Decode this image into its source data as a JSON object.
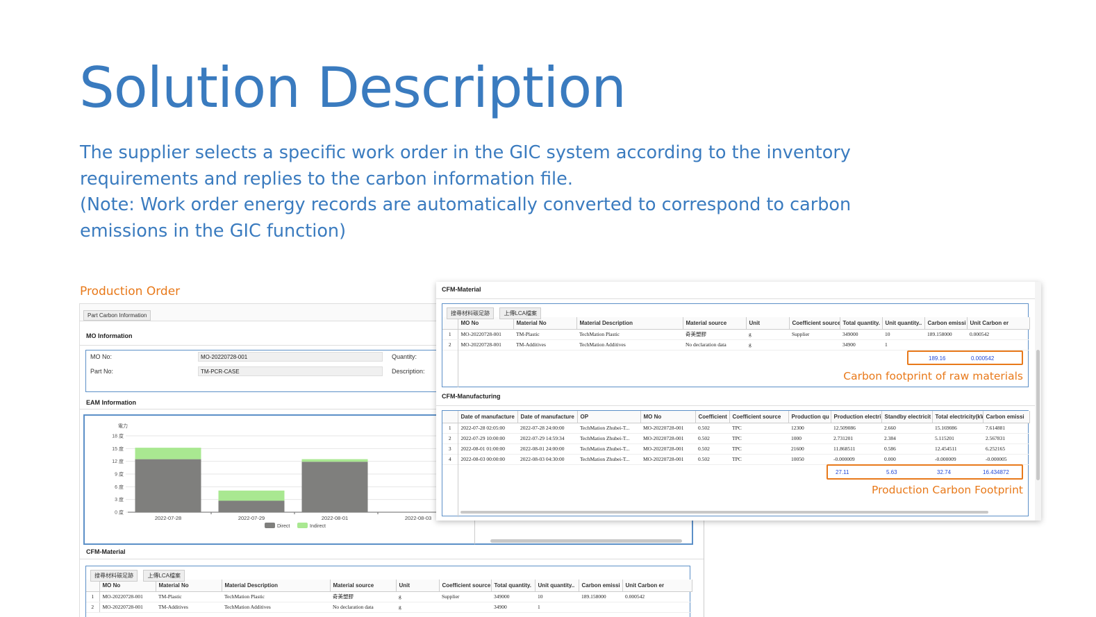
{
  "title": "Solution Description",
  "description": [
    "The supplier selects a specific work order in the GIC system according to the inventory",
    "requirements and replies to the carbon information file.",
    "(Note: Work order energy records are automatically converted to correspond to carbon",
    "emissions in the GIC function)"
  ],
  "production_order_label": "Production Order",
  "back": {
    "tab_label": "Part Carbon Information",
    "mo_section": "MO Information",
    "mo_no_label": "MO No:",
    "mo_no_value": "MO-20220728-001",
    "quantity_label": "Quantity:",
    "part_no_label": "Part No:",
    "part_no_value": "TM-PCR-CASE",
    "description_label": "Description:",
    "eam_section": "EAM Information",
    "cfm_material_section": "CFM-Material",
    "btn_search": "搜尋材料碳足跡",
    "btn_upload": "上傳LCA檔案",
    "headers": [
      "",
      "MO No",
      "Material No",
      "Material Description",
      "Material source",
      "Unit",
      "Coefficient source",
      "Total quantity.",
      "Unit quantity..",
      "Carbon emissi",
      "Unit Carbon er"
    ],
    "rows": [
      [
        "1",
        "MO-20220728-001",
        "TM-Plastic",
        "TechMation Plastic",
        "奇美塑膠",
        "g",
        "Supplier",
        "349000",
        "10",
        "189.158000",
        "0.000542"
      ],
      [
        "2",
        "MO-20220728-001",
        "TM-Additives",
        "TechMation Additives",
        "No declaration data",
        "g",
        "",
        "34900",
        "1",
        "",
        ""
      ]
    ]
  },
  "chart_data": {
    "type": "bar",
    "stacked": true,
    "unit_label": "電力",
    "categories": [
      "2022-07-28",
      "2022-07-29",
      "2022-08-01",
      "2022-08-03"
    ],
    "series": [
      {
        "name": "Direct",
        "values": [
          12.5,
          2.7,
          11.9,
          0
        ],
        "color": "#7f7f7d"
      },
      {
        "name": "Indirect",
        "values": [
          2.7,
          2.4,
          0.6,
          0
        ],
        "color": "#a9e891"
      }
    ],
    "yticks": [
      "18 度",
      "15 度",
      "12 度",
      "9 度",
      "6 度",
      "3 度",
      "0 度"
    ],
    "ylim": [
      0,
      18
    ],
    "legend_position": "bottom"
  },
  "front": {
    "material_section": "CFM-Material",
    "btn_search": "搜尋材料碳足跡",
    "btn_upload": "上傳LCA檔案",
    "material_headers": [
      "",
      "MO No",
      "Material No",
      "Material Description",
      "Material source",
      "Unit",
      "Coefficient source",
      "Total quantity.",
      "Unit quantity..",
      "Carbon emissi",
      "Unit Carbon er"
    ],
    "material_rows": [
      [
        "1",
        "MO-20220728-001",
        "TM-Plastic",
        "TechMation Plastic",
        "奇美塑膠",
        "g",
        "Supplier",
        "349000",
        "10",
        "189.158000",
        "0.000542"
      ],
      [
        "2",
        "MO-20220728-001",
        "TM-Additives",
        "TechMation Additives",
        "No declaration data",
        "g",
        "",
        "34900",
        "1",
        "",
        ""
      ]
    ],
    "material_sum": [
      "189.16",
      "0.000542"
    ],
    "material_annotation": "Carbon footprint of raw materials",
    "manufacturing_section": "CFM-Manufacturing",
    "mfg_headers": [
      "",
      "Date of manufacture",
      "Date of manufacture",
      "OP",
      "MO No",
      "Coefficient",
      "Coefficient source",
      "Production qu",
      "Production electri",
      "Standby electricit",
      "Total electricity(kW",
      "Carbon emissi"
    ],
    "mfg_rows": [
      [
        "1",
        "2022-07-28 02:05:00",
        "2022-07-28 24:00:00",
        "TechMation Zhubei-T...",
        "MO-20220728-001",
        "0.502",
        "TPC",
        "12300",
        "12.509086",
        "2.660",
        "15.169086",
        "7.614881"
      ],
      [
        "2",
        "2022-07-29 10:00:00",
        "2022-07-29 14:59:34",
        "TechMation Zhubei-T...",
        "MO-20220728-001",
        "0.502",
        "TPC",
        "1000",
        "2.731201",
        "2.384",
        "5.115201",
        "2.567831"
      ],
      [
        "3",
        "2022-08-01 01:00:00",
        "2022-08-01 24:00:00",
        "TechMation Zhubei-T...",
        "MO-20220728-001",
        "0.502",
        "TPC",
        "21600",
        "11.868511",
        "0.586",
        "12.454511",
        "6.252165"
      ],
      [
        "4",
        "2022-08-03 00:00:00",
        "2022-08-03 04:30:00",
        "TechMation Zhubei-T...",
        "MO-20220728-001",
        "0.502",
        "TPC",
        "10050",
        "-0.000009",
        "0.000",
        "-0.000009",
        "-0.000005"
      ]
    ],
    "mfg_sum": [
      "27.11",
      "5.63",
      "32.74",
      "16.434872"
    ],
    "mfg_annotation": "Production Carbon Footprint"
  }
}
